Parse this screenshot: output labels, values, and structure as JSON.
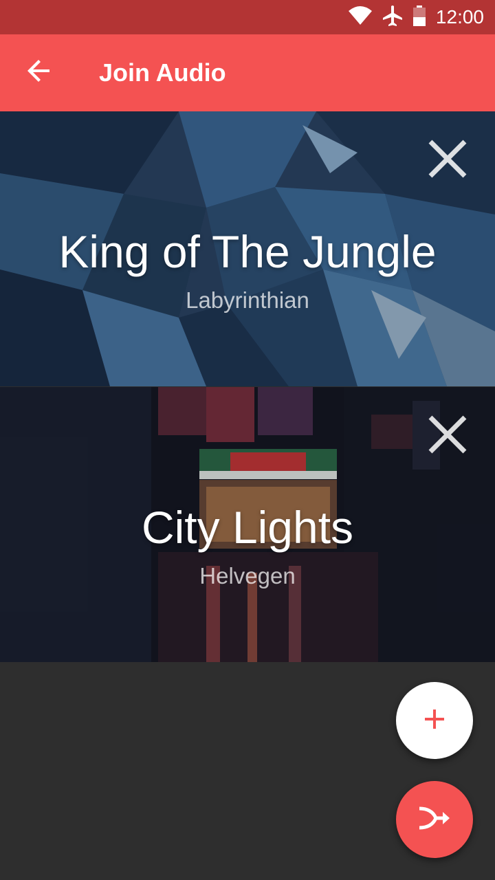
{
  "status_bar": {
    "time": "12:00",
    "icons": [
      "wifi-icon",
      "airplane-mode-icon",
      "battery-icon"
    ]
  },
  "app_bar": {
    "title": "Join Audio",
    "back_icon": "arrow-back-icon"
  },
  "tracks": [
    {
      "title": "King of The Jungle",
      "artist": "Labyrinthian",
      "remove_icon": "close-icon"
    },
    {
      "title": "City Lights",
      "artist": "Helvegen",
      "remove_icon": "close-icon"
    }
  ],
  "fabs": {
    "add_icon": "plus-icon",
    "merge_icon": "merge-icon"
  },
  "colors": {
    "status_bar": "#b33434",
    "primary": "#f45252",
    "background": "#2e2e2e",
    "fab_add": "#ffffff"
  }
}
